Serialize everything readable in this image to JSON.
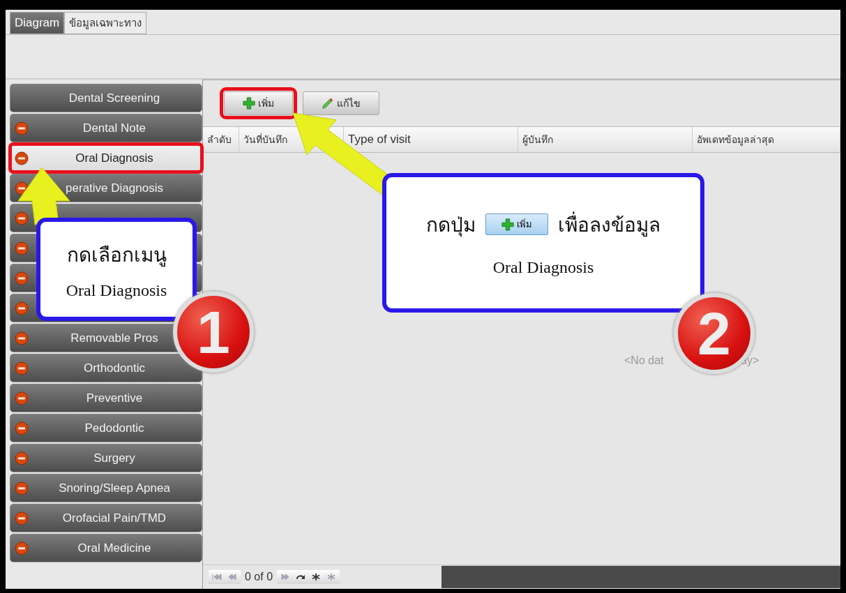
{
  "tabs": [
    {
      "label": "Diagram",
      "selected": true
    },
    {
      "label": "ข้อมูลเฉพาะทาง",
      "selected": false
    }
  ],
  "sidebar": {
    "items": [
      {
        "kind": "plain",
        "label": "Dental Screening",
        "selected": false,
        "highlighted": false
      },
      {
        "kind": "minus",
        "label": "Dental Note",
        "selected": false,
        "highlighted": false
      },
      {
        "kind": "minus",
        "label": "Oral Diagnosis",
        "selected": true,
        "highlighted": true
      },
      {
        "kind": "minus",
        "label": "perative Diagnosis",
        "selected": false,
        "highlighted": false
      },
      {
        "kind": "minus",
        "selected": false,
        "highlighted": false
      },
      {
        "kind": "minus",
        "selected": false,
        "highlighted": false
      },
      {
        "kind": "minus",
        "selected": false,
        "highlighted": false
      },
      {
        "kind": "minus",
        "selected": false,
        "highlighted": false
      },
      {
        "kind": "minus",
        "label": "Removable Pros",
        "selected": false,
        "highlighted": false
      },
      {
        "kind": "minus",
        "label": "Orthodontic",
        "selected": false,
        "highlighted": false
      },
      {
        "kind": "minus",
        "label": "Preventive",
        "selected": false,
        "highlighted": false
      },
      {
        "kind": "minus",
        "label": "Pedodontic",
        "selected": false,
        "highlighted": false
      },
      {
        "kind": "minus",
        "label": "Surgery",
        "selected": false,
        "highlighted": false
      },
      {
        "kind": "minus",
        "label": "Snoring/Sleep Apnea",
        "selected": false,
        "highlighted": false
      },
      {
        "kind": "minus",
        "label": "Orofacial Pain/TMD",
        "selected": false,
        "highlighted": false
      },
      {
        "kind": "minus",
        "label": "Oral Medicine",
        "selected": false,
        "highlighted": false
      }
    ]
  },
  "toolbar": {
    "buttons": [
      {
        "kind": "add",
        "label": "เพิ่ม",
        "highlighted": true
      },
      {
        "kind": "edit",
        "label": "แก้ไข",
        "highlighted": false
      }
    ]
  },
  "grid": {
    "columns": [
      "ลำดับ",
      "วันที่บันทึก",
      "Type of visit",
      "ผู้บันทึก",
      "อัพเดทข้อมูลล่าสุด"
    ],
    "empty_text_parts": [
      "<No dat",
      "ay>"
    ],
    "navigator": {
      "position": "0 of 0"
    }
  },
  "annotations": {
    "callout_1": {
      "lines": [
        "กดเลือกเมนู",
        "Oral Diagnosis"
      ]
    },
    "callout_2": {
      "before": "กดปุ่ม",
      "button": "เพิ่ม",
      "after": "เพื่อลงข้อมูล",
      "line_2": "Oral Diagnosis"
    },
    "badges": [
      {
        "number": "1"
      },
      {
        "number": "2"
      }
    ]
  }
}
